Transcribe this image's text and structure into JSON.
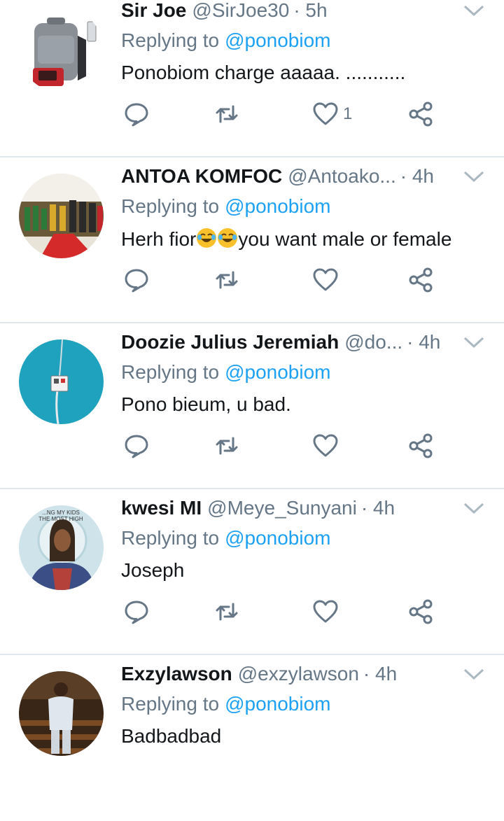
{
  "reply_prefix": "Replying to",
  "tweets": [
    {
      "name": "Sir Joe",
      "handle": "@SirJoe30",
      "time": "· 5h",
      "reply_to": "@ponobiom",
      "text": "Ponobiom charge aaaaa. ...........",
      "like_count": "1",
      "avatar": "backpack-with-usb-charger"
    },
    {
      "name": "ANTOA KOMFOC",
      "handle": "@Antoako...",
      "time": "· 4h",
      "reply_to": "@ponobiom",
      "text_before": "Herh fior",
      "emoji": "tears-of-joy-emoji",
      "text_after": "you want male or female",
      "like_count": "",
      "avatar": "group-photo-red-carpet"
    },
    {
      "name": "Doozie Julius Jeremiah",
      "handle": "@do...",
      "time": "· 4h",
      "reply_to": "@ponobiom",
      "text": "Pono bieum, u bad.",
      "like_count": "",
      "avatar": "wall-socket-on-blue-wall"
    },
    {
      "name": "kwesi MI",
      "handle": "@Meye_Sunyani",
      "time": "· 4h",
      "reply_to": "@ponobiom",
      "text": "Joseph",
      "like_count": "",
      "avatar": "portrait-illustration",
      "avatar_text_1": "...NG MY KIDS",
      "avatar_text_2": "THE MOST HIGH"
    },
    {
      "name": "Exzylawson",
      "handle": "@exzylawson",
      "time": "· 4h",
      "reply_to": "@ponobiom",
      "text": "Badbadbad",
      "like_count": "",
      "avatar": "man-standing-in-church"
    }
  ],
  "colors": {
    "link": "#1da1f2",
    "secondary": "#657786",
    "divider": "#e1e8ed",
    "icon": "#657786"
  },
  "icons": [
    "reply-icon",
    "retweet-icon",
    "like-icon",
    "share-icon",
    "chevron-down-icon"
  ]
}
